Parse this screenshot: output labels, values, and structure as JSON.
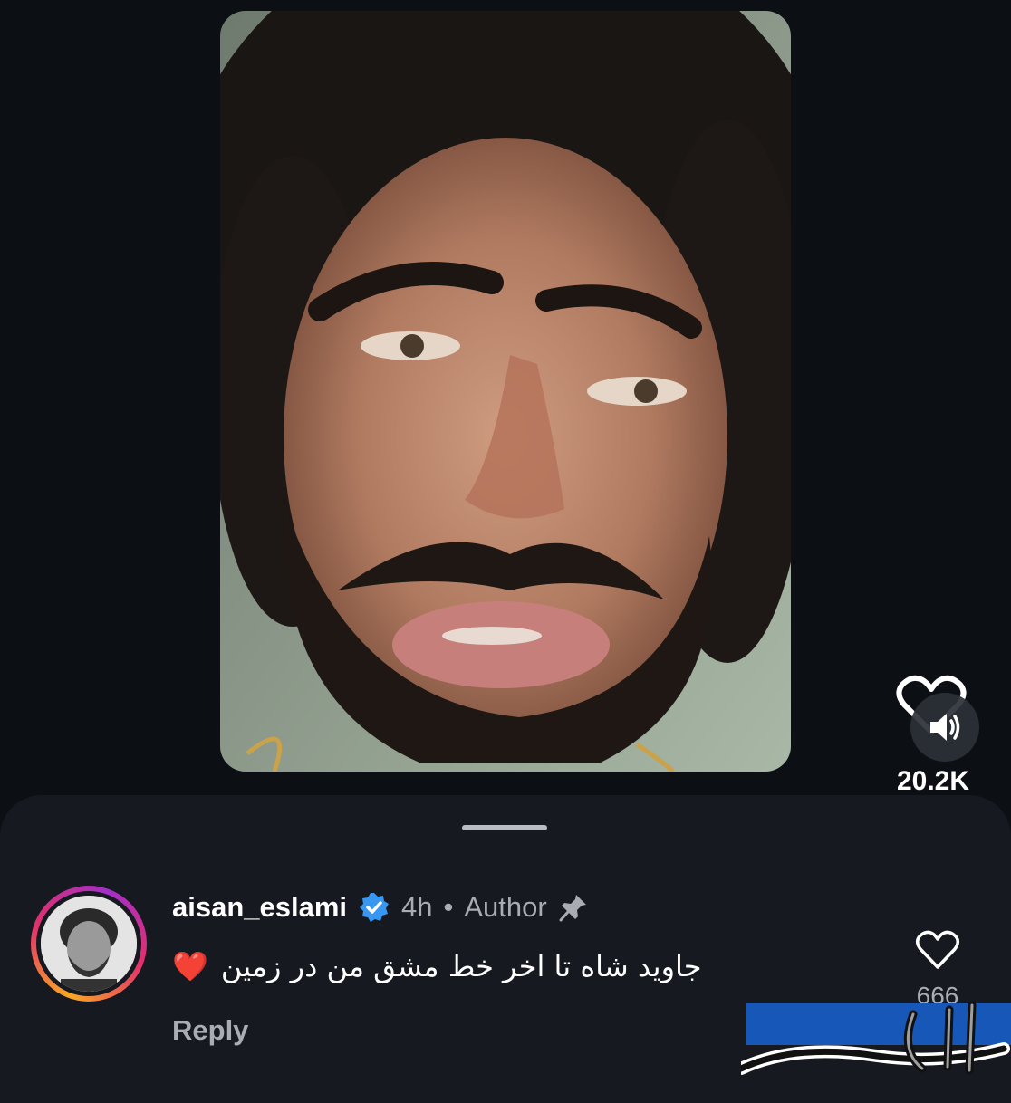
{
  "video": {
    "like_count": "20.2K"
  },
  "icons": {
    "like": "heart-outline-icon",
    "mute": "speaker-volume-icon",
    "verified": "verified-badge-icon",
    "pinned": "pin-icon",
    "comment_like": "heart-outline-icon"
  },
  "comment": {
    "username": "aisan_eslami",
    "time": "4h",
    "separator": "•",
    "author_label": "Author",
    "text": "جاوید شاه تا اخر خط مشق من در زمین",
    "emoji": "❤️",
    "reply_label": "Reply",
    "like_count": "666"
  },
  "watermark": {
    "text": "تابناک"
  },
  "colors": {
    "background": "#0c0f14",
    "sheet": "#16191f",
    "verified_blue": "#3897f0",
    "muted_text": "#a8acb3",
    "watermark_blue": "#1757b8"
  }
}
